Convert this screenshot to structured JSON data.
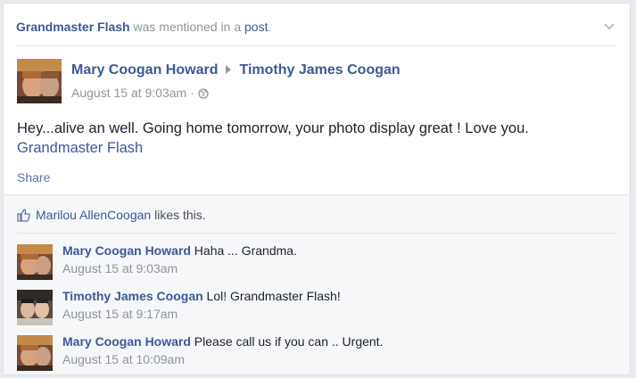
{
  "story": {
    "mentioned_name": "Grandmaster Flash",
    "mention_text": " was mentioned in a ",
    "post_link": "post",
    "period": "."
  },
  "post": {
    "author": "Mary Coogan Howard",
    "recipient": "Timothy James Coogan",
    "timestamp": "August 15 at 9:03am",
    "dot": "·",
    "privacy_icon": "globe-icon",
    "body": "Hey...alive an well. Going home tomorrow, your photo display great ! Love you.",
    "tag": "Grandmaster Flash",
    "share_label": "Share"
  },
  "likes": {
    "liker": "Marilou AllenCoogan",
    "suffix": " likes this."
  },
  "comments": [
    {
      "name": "Mary Coogan Howard",
      "text": " Haha ... Grandma.",
      "time": "August 15 at 9:03am"
    },
    {
      "name": "Timothy James Coogan",
      "text": " Lol! Grandmaster Flash!",
      "time": "August 15 at 9:17am"
    },
    {
      "name": "Mary Coogan Howard",
      "text": " Please call us if you can .. Urgent.",
      "time": "August 15 at 10:09am"
    }
  ],
  "colors": {
    "link": "#3b5998",
    "muted": "#90949c",
    "feedback_bg": "#f6f7f9"
  }
}
